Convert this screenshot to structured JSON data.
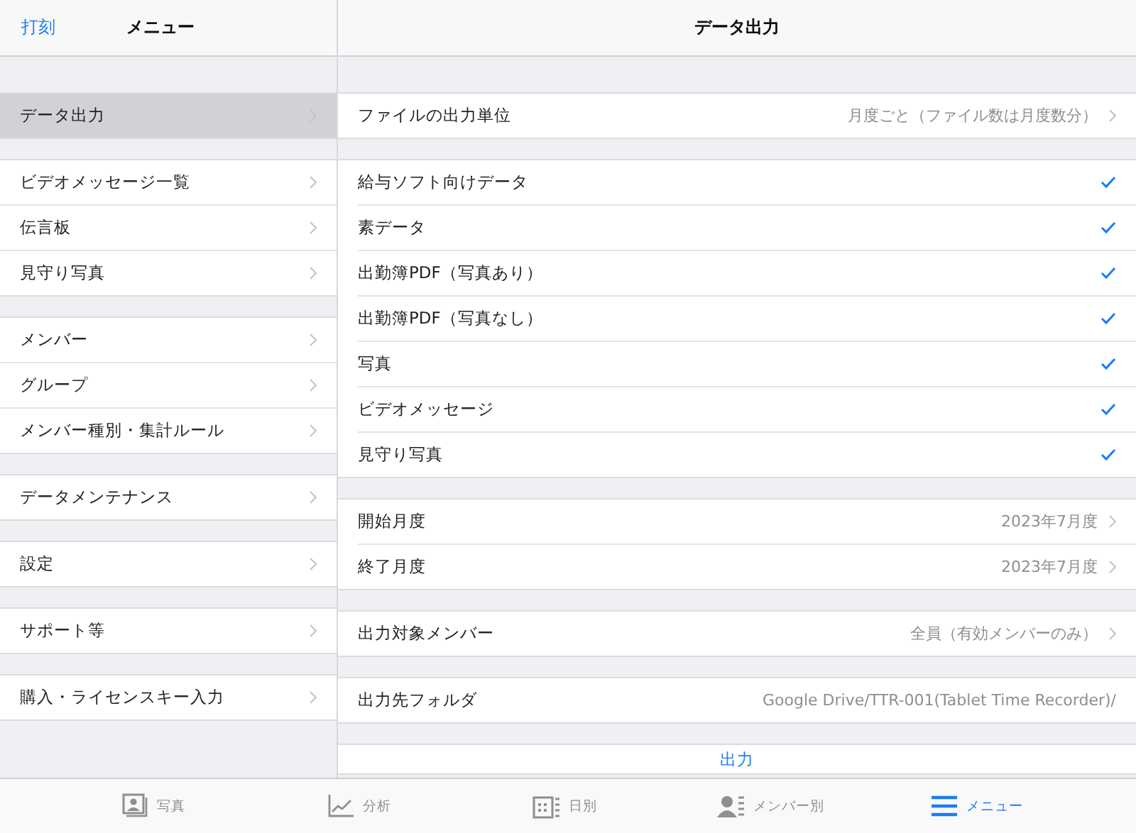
{
  "sidebar": {
    "back_link": "打刻",
    "title": "メニュー",
    "sections": [
      [
        {
          "label": "データ出力",
          "selected": true
        }
      ],
      [
        {
          "label": "ビデオメッセージ一覧",
          "selected": false
        },
        {
          "label": "伝言板",
          "selected": false
        },
        {
          "label": "見守り写真",
          "selected": false
        }
      ],
      [
        {
          "label": "メンバー",
          "selected": false
        },
        {
          "label": "グループ",
          "selected": false
        },
        {
          "label": "メンバー種別・集計ルール",
          "selected": false
        }
      ],
      [
        {
          "label": "データメンテナンス",
          "selected": false
        }
      ],
      [
        {
          "label": "設定",
          "selected": false
        }
      ],
      [
        {
          "label": "サポート等",
          "selected": false
        }
      ],
      [
        {
          "label": "購入・ライセンスキー入力",
          "selected": false
        }
      ]
    ]
  },
  "detail": {
    "title": "データ出力",
    "sections": [
      [
        {
          "kind": "disclosure",
          "label": "ファイルの出力単位",
          "value": "月度ごと（ファイル数は月度数分）"
        }
      ],
      [
        {
          "kind": "check",
          "label": "給与ソフト向けデータ",
          "checked": true
        },
        {
          "kind": "check",
          "label": "素データ",
          "checked": true
        },
        {
          "kind": "check",
          "label": "出勤簿PDF（写真あり）",
          "checked": true
        },
        {
          "kind": "check",
          "label": "出勤簿PDF（写真なし）",
          "checked": true
        },
        {
          "kind": "check",
          "label": "写真",
          "checked": true
        },
        {
          "kind": "check",
          "label": "ビデオメッセージ",
          "checked": true
        },
        {
          "kind": "check",
          "label": "見守り写真",
          "checked": true
        }
      ],
      [
        {
          "kind": "disclosure",
          "label": "開始月度",
          "value": "2023年7月度"
        },
        {
          "kind": "disclosure",
          "label": "終了月度",
          "value": "2023年7月度"
        }
      ],
      [
        {
          "kind": "disclosure",
          "label": "出力対象メンバー",
          "value": "全員（有効メンバーのみ）"
        }
      ],
      [
        {
          "kind": "plain",
          "label": "出力先フォルダ",
          "value": "Google Drive/TTR-001(Tablet Time Recorder)/"
        }
      ],
      [
        {
          "kind": "action",
          "label": "出力"
        }
      ]
    ]
  },
  "tab_bar": [
    {
      "kind": "photo",
      "label": "写真",
      "selected": false
    },
    {
      "kind": "chart",
      "label": "分析",
      "selected": false
    },
    {
      "kind": "calendar",
      "label": "日別",
      "selected": false
    },
    {
      "kind": "member",
      "label": "メンバー別",
      "selected": false
    },
    {
      "kind": "menu",
      "label": "メニュー",
      "selected": true
    }
  ]
}
